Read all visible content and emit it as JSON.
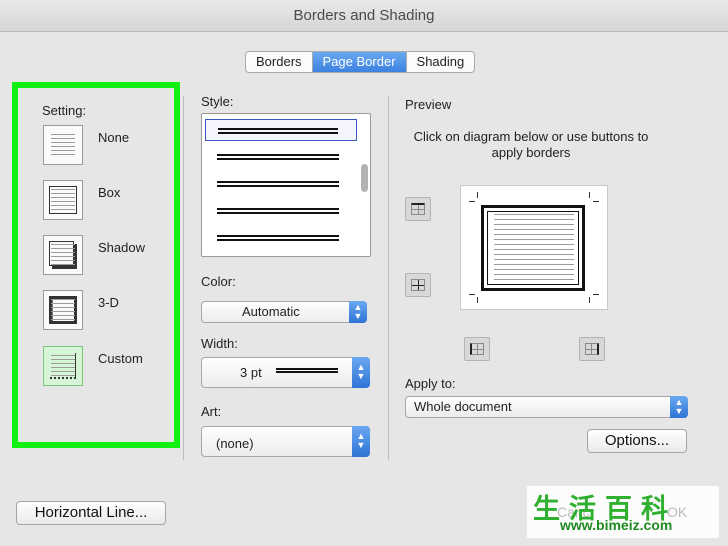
{
  "window": {
    "title": "Borders and Shading"
  },
  "tabs": [
    {
      "label": "Borders"
    },
    {
      "label": "Page Border"
    },
    {
      "label": "Shading"
    }
  ],
  "active_tab": "Page Border",
  "setting": {
    "label": "Setting:",
    "options": [
      {
        "label": "None"
      },
      {
        "label": "Box"
      },
      {
        "label": "Shadow"
      },
      {
        "label": "3-D"
      },
      {
        "label": "Custom"
      }
    ],
    "selected": "Custom"
  },
  "style": {
    "label": "Style:"
  },
  "color": {
    "label": "Color:",
    "value": "Automatic"
  },
  "width": {
    "label": "Width:",
    "value": "3 pt"
  },
  "art": {
    "label": "Art:",
    "value": "(none)"
  },
  "preview": {
    "label": "Preview",
    "instruction": "Click on diagram below or use buttons to apply borders"
  },
  "apply_to": {
    "label": "Apply to:",
    "value": "Whole document"
  },
  "buttons": {
    "options": "Options...",
    "horizontal_line": "Horizontal Line...",
    "cancel_partial": "Canc",
    "ok_partial": "OK"
  },
  "watermark": {
    "chinese": "生活百科",
    "url": "www.bimeiz.com"
  },
  "colors": {
    "highlight": "#12ef12",
    "accent": "#3c82e0"
  }
}
